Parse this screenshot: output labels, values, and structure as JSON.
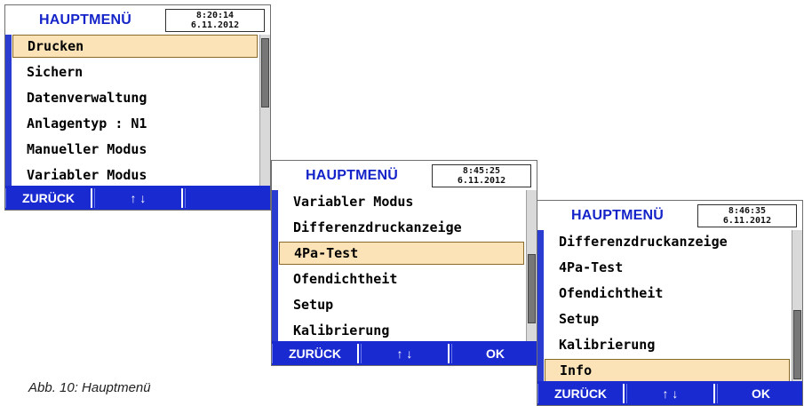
{
  "caption": "Abb. 10: Hauptmenü",
  "screens": [
    {
      "title": "HAUPTMENÜ",
      "time": "8:20:14",
      "date": "6.11.2012",
      "items": [
        "Drucken",
        "Sichern",
        "Datenverwaltung",
        "Anlagentyp : N1",
        "Manueller Modus",
        "Variabler Modus"
      ],
      "selected_index": 0,
      "buttons": [
        "ZURÜCK",
        "↑ ↓",
        ""
      ]
    },
    {
      "title": "HAUPTMENÜ",
      "time": "8:45:25",
      "date": "6.11.2012",
      "items": [
        "Variabler Modus",
        "Differenzdruckanzeige",
        "4Pa-Test",
        "Ofendichtheit",
        "Setup",
        "Kalibrierung"
      ],
      "selected_index": 2,
      "buttons": [
        "ZURÜCK",
        "↑ ↓",
        "OK"
      ]
    },
    {
      "title": "HAUPTMENÜ",
      "time": "8:46:35",
      "date": "6.11.2012",
      "items": [
        "Differenzdruckanzeige",
        "4Pa-Test",
        "Ofendichtheit",
        "Setup",
        "Kalibrierung",
        "Info"
      ],
      "selected_index": 5,
      "buttons": [
        "ZURÜCK",
        "↑ ↓",
        "OK"
      ]
    }
  ],
  "colors": {
    "title_blue": "#1524c9",
    "footer_blue": "#1a2ad1",
    "selection": "#fbe3b7"
  }
}
